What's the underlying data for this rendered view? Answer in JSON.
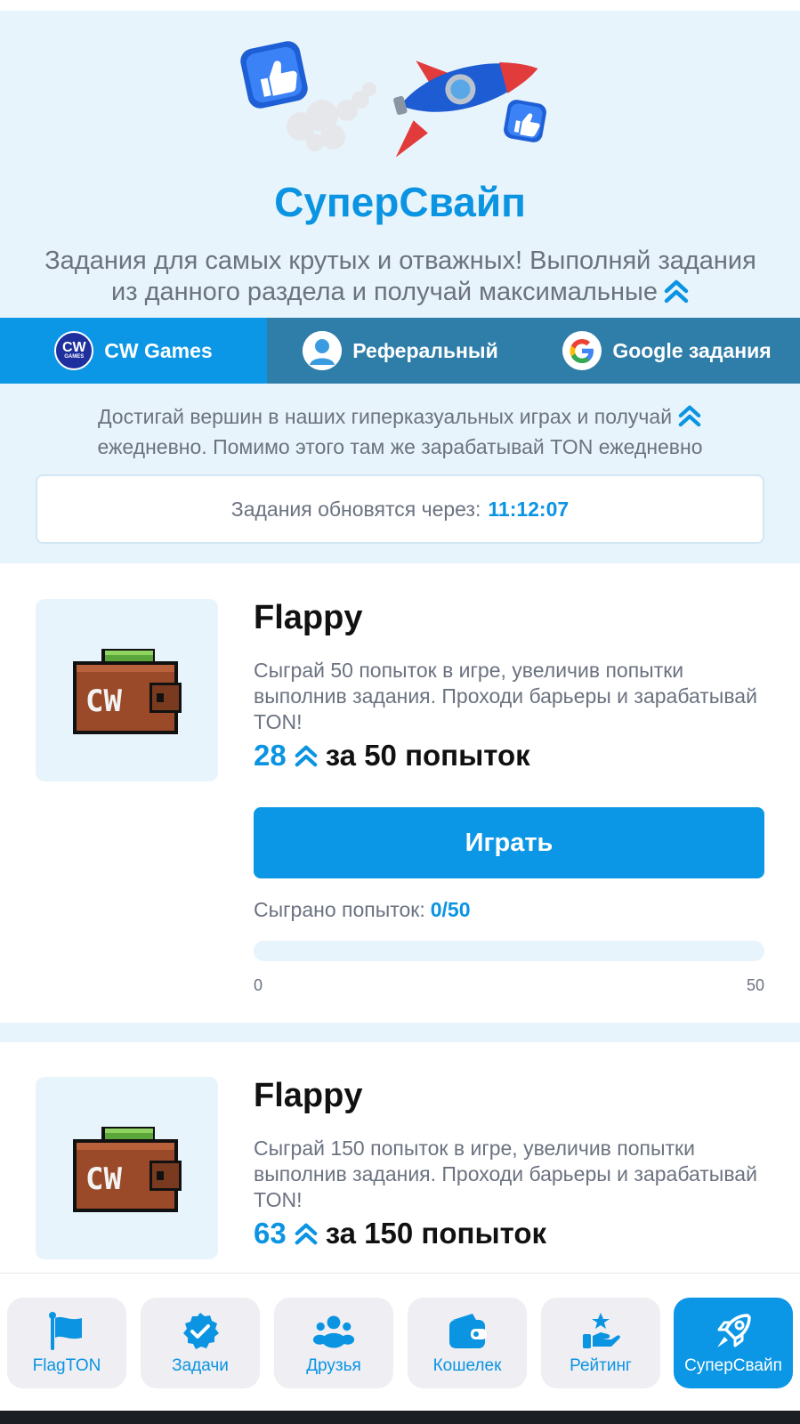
{
  "hero": {
    "title": "СуперСвайп",
    "description": "Задания для самых крутых и отважных! Выполняй задания из данного раздела и получай максимальные",
    "description_icon": "double-chevron-up-icon"
  },
  "tabs": [
    {
      "label": "CW Games",
      "icon": "cw-games-logo",
      "active": true,
      "icon_text": "CW",
      "icon_subtext": "GAMES"
    },
    {
      "label": "Реферальный",
      "icon": "user-icon",
      "active": false
    },
    {
      "label": "Google задания",
      "icon": "google-icon",
      "active": false
    }
  ],
  "section": {
    "description": "Достигай вершин в наших гиперказуальных играх и получай",
    "description_2": "ежедневно. Помимо этого там же зарабатывай TON ежедневно",
    "timer_label": "Задания обновятся через:",
    "timer_value": "11:12:07"
  },
  "tasks": [
    {
      "title": "Flappy",
      "description": "Сыграй 50 попыток в игре, увеличив попытки выполнив задания. Проходи барьеры и зарабатывай TON!",
      "reward_amount": "28",
      "reward_suffix": "за 50 попыток",
      "button_label": "Играть",
      "played_label": "Сыграно попыток:",
      "played_value": "0/50",
      "progress": 0,
      "progress_min": "0",
      "progress_max": "50",
      "thumb_text": "CW"
    },
    {
      "title": "Flappy",
      "description": "Сыграй 150 попыток в игре, увеличив попытки выполнив задания. Проходи барьеры и зарабатывай TON!",
      "reward_amount": "63",
      "reward_suffix": "за 150 попыток",
      "thumb_text": "CW"
    }
  ],
  "nav": [
    {
      "label": "FlagTON",
      "icon": "flag-icon",
      "active": false
    },
    {
      "label": "Задачи",
      "icon": "check-badge-icon",
      "active": false
    },
    {
      "label": "Друзья",
      "icon": "friends-icon",
      "active": false
    },
    {
      "label": "Кошелек",
      "icon": "wallet-icon",
      "active": false
    },
    {
      "label": "Рейтинг",
      "icon": "rating-icon",
      "active": false
    },
    {
      "label": "СуперСвайп",
      "icon": "rocket-icon",
      "active": true
    }
  ],
  "colors": {
    "accent": "#0b97e5",
    "accent_text": "#0a94e2",
    "tab_inactive": "#2f7ea9",
    "light_bg": "#e8f4fc",
    "muted_text": "#6b7280"
  }
}
